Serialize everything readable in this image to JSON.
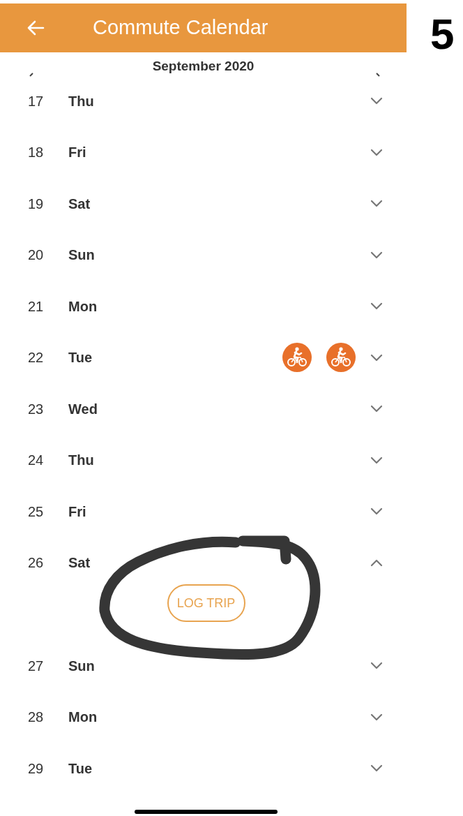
{
  "header": {
    "title": "Commute Calendar"
  },
  "step_number": "5",
  "month": "September 2020",
  "days": [
    {
      "day": "17",
      "weekday": "Thu",
      "expanded": false
    },
    {
      "day": "18",
      "weekday": "Fri",
      "expanded": false
    },
    {
      "day": "19",
      "weekday": "Sat",
      "expanded": false
    },
    {
      "day": "20",
      "weekday": "Sun",
      "expanded": false
    },
    {
      "day": "21",
      "weekday": "Mon",
      "expanded": false
    },
    {
      "day": "22",
      "weekday": "Tue",
      "expanded": false,
      "trips": [
        {
          "kind": "bike"
        },
        {
          "kind": "bike"
        }
      ]
    },
    {
      "day": "23",
      "weekday": "Wed",
      "expanded": false
    },
    {
      "day": "24",
      "weekday": "Thu",
      "expanded": false
    },
    {
      "day": "25",
      "weekday": "Fri",
      "expanded": false
    },
    {
      "day": "26",
      "weekday": "Sat",
      "expanded": true,
      "action": "LOG TRIP"
    },
    {
      "day": "27",
      "weekday": "Sun",
      "expanded": false
    },
    {
      "day": "28",
      "weekday": "Mon",
      "expanded": false
    },
    {
      "day": "29",
      "weekday": "Tue",
      "expanded": false
    }
  ]
}
